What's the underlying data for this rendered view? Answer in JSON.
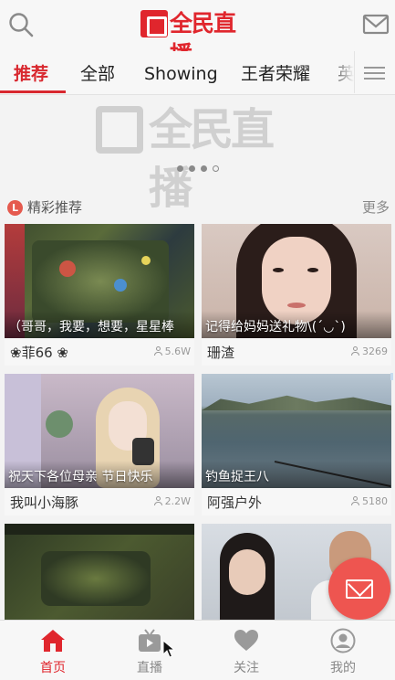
{
  "header": {
    "logo_text": "全民直播",
    "search_icon": "search-icon",
    "mail_icon": "mail-icon"
  },
  "tabs": [
    {
      "label": "推荐",
      "active": true
    },
    {
      "label": "全部",
      "active": false
    },
    {
      "label": "Showing",
      "active": false
    },
    {
      "label": "王者荣耀",
      "active": false
    },
    {
      "label": "英",
      "active": false
    }
  ],
  "banner": {
    "logo_text": "全民直播",
    "dots": 4,
    "active_dot": 3
  },
  "section": {
    "badge": "L",
    "title": "精彩推荐",
    "more": "更多"
  },
  "cards": [
    {
      "caption": "（哥哥，我要，想要，星星棒",
      "name": "❀菲66 ❀",
      "viewers": "5.6W"
    },
    {
      "caption": "记得给妈妈送礼物\\(´◡`)",
      "name": "珊渣",
      "viewers": "3269"
    },
    {
      "caption": "祝天下各位母亲 节日快乐",
      "name": "我叫小海豚",
      "viewers": "2.2W"
    },
    {
      "caption": "钓鱼捉王八",
      "name": "阿强户外",
      "viewers": "5180"
    },
    {
      "caption": "",
      "name": "",
      "viewers": ""
    },
    {
      "caption": "",
      "name": "",
      "viewers": ""
    }
  ],
  "bottom_nav": [
    {
      "label": "首页",
      "icon": "home-icon",
      "active": true
    },
    {
      "label": "直播",
      "icon": "tv-icon",
      "active": false
    },
    {
      "label": "关注",
      "icon": "heart-icon",
      "active": false
    },
    {
      "label": "我的",
      "icon": "profile-icon",
      "active": false
    }
  ],
  "colors": {
    "accent": "#e0262d",
    "fab": "#ee5550",
    "inactive": "#888888"
  }
}
